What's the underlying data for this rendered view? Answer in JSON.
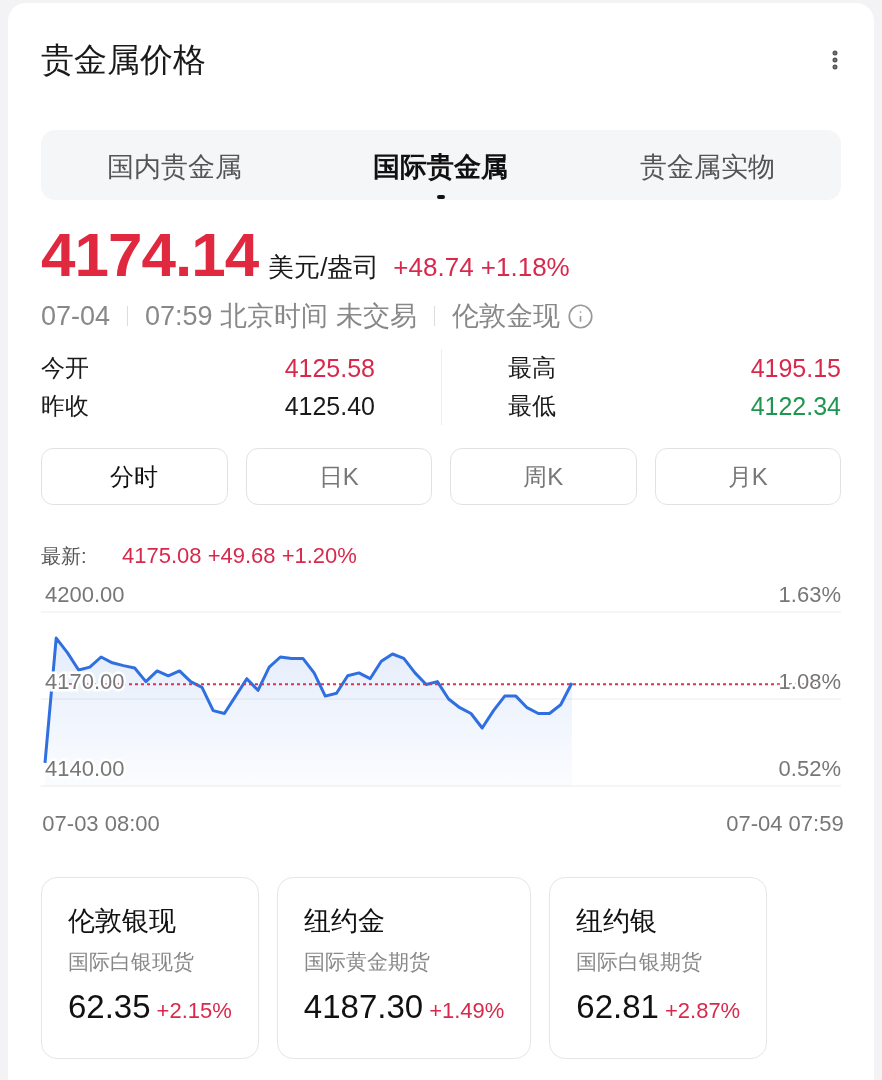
{
  "header": {
    "title": "贵金属价格"
  },
  "tabs": [
    {
      "label": "国内贵金属",
      "selected": false
    },
    {
      "label": "国际贵金属",
      "selected": true
    },
    {
      "label": "贵金属实物",
      "selected": false
    }
  ],
  "quote": {
    "price": "4174.14",
    "unit": "美元/盎司",
    "change": "+48.74 +1.18%",
    "date": "07-04",
    "time_status": "07:59 北京时间 未交易",
    "instrument": "伦敦金现"
  },
  "stats": [
    {
      "label": "今开",
      "value": "4125.58",
      "color": "#d8294c"
    },
    {
      "label": "最高",
      "value": "4195.15",
      "color": "#d8294c"
    },
    {
      "label": "昨收",
      "value": "4125.40",
      "color": "#1a1a1a"
    },
    {
      "label": "最低",
      "value": "4122.34",
      "color": "#1e9650"
    }
  ],
  "periods": [
    {
      "label": "分时",
      "selected": true
    },
    {
      "label": "日K",
      "selected": false
    },
    {
      "label": "周K",
      "selected": false
    },
    {
      "label": "月K",
      "selected": false
    }
  ],
  "chart": {
    "latest_label": "最新:",
    "latest_value": "4175.08 +49.68 +1.20%",
    "right_labels": [
      "1.63%",
      "1.08%",
      "0.52%"
    ],
    "chart_data": {
      "type": "area",
      "categories": [
        null,
        null,
        null,
        null,
        null,
        "07-03 08:00",
        null,
        null,
        null,
        null,
        null,
        null,
        null,
        null,
        null,
        null,
        null,
        null,
        null,
        null,
        null,
        null,
        null,
        null,
        null,
        null,
        null,
        null,
        null,
        null,
        null,
        null,
        null,
        null,
        null,
        null,
        null,
        null,
        null,
        null,
        null,
        null,
        null,
        null,
        null,
        null,
        null,
        null,
        null,
        null,
        null,
        null,
        null,
        null,
        null,
        null,
        null,
        null,
        null,
        null,
        null,
        null,
        null,
        null,
        null,
        null,
        "07-04 07:59",
        null,
        null,
        null,
        null,
        null
      ],
      "ylim": [
        4140,
        4200
      ],
      "yticks": [
        {
          "value": 4200,
          "label": "4200.00"
        },
        {
          "value": 4170,
          "label": "4170.00"
        },
        {
          "value": 4140,
          "label": "4140.00"
        }
      ],
      "series": [
        {
          "color": "#2f6fe0",
          "values": [
            4148,
            4191,
            4186,
            4180,
            4181,
            4184.5,
            4182.5,
            4181.5,
            4180.7,
            4176,
            4179.7,
            4178,
            4179.7,
            4176,
            4174,
            4166,
            4165,
            4171,
            4177,
            4173,
            4181,
            4184.5,
            4184,
            4184,
            4179,
            4171,
            4172,
            4178,
            4179,
            4177,
            4183,
            4185.5,
            4184,
            4179,
            4175,
            4176,
            4170,
            4167,
            4165,
            4160,
            4166,
            4171,
            4171,
            4167,
            4165,
            4165,
            4168,
            4175.5,
            null,
            null,
            null,
            null,
            null,
            null,
            null,
            null,
            null,
            null,
            null,
            null,
            null,
            null,
            null,
            null,
            null,
            null,
            null,
            null,
            null,
            null,
            null,
            null
          ]
        }
      ],
      "ref_lines": [
        {
          "axis": "y",
          "value": 4175.08,
          "color": "#e0304f"
        }
      ]
    }
  },
  "markets": [
    {
      "name": "伦敦银现",
      "description": "国际白银现货",
      "price": "62.35",
      "change": "+2.15%"
    },
    {
      "name": "纽约金",
      "description": "国际黄金期货",
      "price": "4187.30",
      "change": "+1.49%"
    },
    {
      "name": "纽约银",
      "description": "国际白银期货",
      "price": "62.81",
      "change": "+2.87%"
    }
  ]
}
